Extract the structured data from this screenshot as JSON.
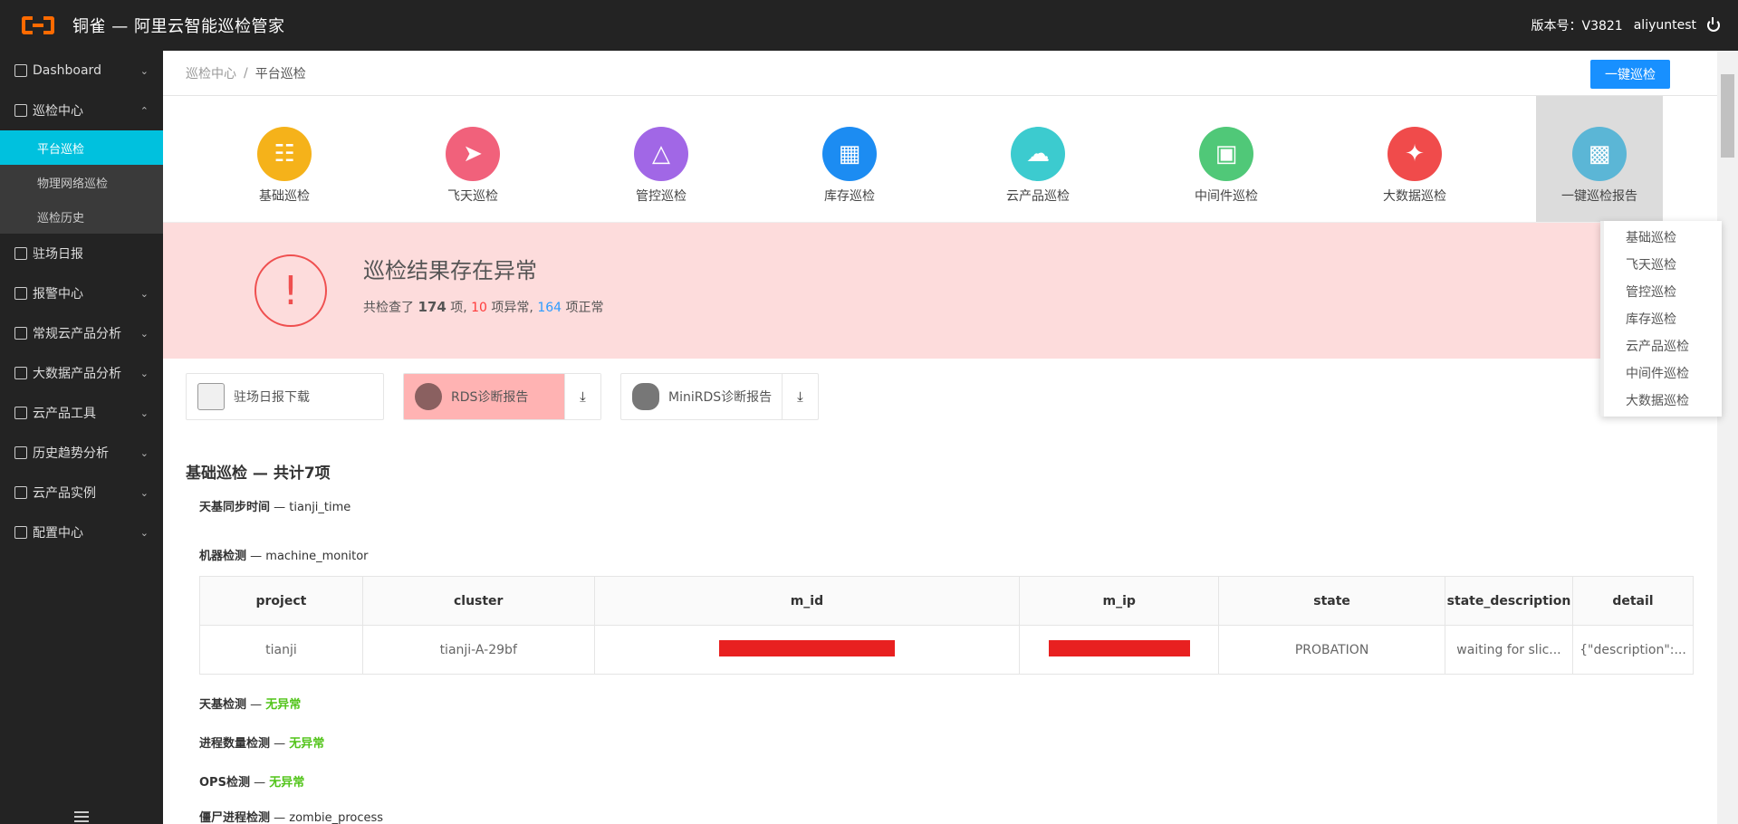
{
  "header": {
    "app_title": "铜雀 — 阿里云智能巡检管家",
    "version": "版本号：V3821",
    "username": "aliyuntest"
  },
  "sidebar": {
    "items": [
      {
        "label": "Dashboard",
        "icon": "home-icon",
        "expanded": false
      },
      {
        "label": "巡检中心",
        "icon": "inspect-icon",
        "expanded": true
      },
      {
        "label": "驻场日报",
        "icon": "edit-icon"
      },
      {
        "label": "报警中心",
        "icon": "alarm-icon",
        "expanded": false
      },
      {
        "label": "常规云产品分析",
        "icon": "cube-icon",
        "expanded": false
      },
      {
        "label": "大数据产品分析",
        "icon": "chart-icon",
        "expanded": false
      },
      {
        "label": "云产品工具",
        "icon": "tool-icon",
        "expanded": false
      },
      {
        "label": "历史趋势分析",
        "icon": "history-icon",
        "expanded": false
      },
      {
        "label": "云产品实例",
        "icon": "instance-icon",
        "expanded": false
      },
      {
        "label": "配置中心",
        "icon": "gear-icon",
        "expanded": false
      }
    ],
    "sub_items": [
      "平台巡检",
      "物理网络巡检",
      "巡检历史"
    ]
  },
  "breadcrumb": {
    "parent": "巡检中心",
    "separator": "/",
    "current": "平台巡检"
  },
  "actions": {
    "one_click": "一键巡检"
  },
  "categories": [
    {
      "label": "基础巡检",
      "color": "#f5b21a",
      "icon": "document-search-icon"
    },
    {
      "label": "飞天巡检",
      "color": "#f1617b",
      "icon": "rocket-icon"
    },
    {
      "label": "管控巡检",
      "color": "#a167e6",
      "icon": "network-icon"
    },
    {
      "label": "库存巡检",
      "color": "#1c8cf2",
      "icon": "grid-icon"
    },
    {
      "label": "云产品巡检",
      "color": "#3ccbcf",
      "icon": "cloud-icon"
    },
    {
      "label": "中间件巡检",
      "color": "#50c878",
      "icon": "box-icon"
    },
    {
      "label": "大数据巡检",
      "color": "#f04b4b",
      "icon": "nodes-icon"
    },
    {
      "label": "一键巡检报告",
      "color": "#5bb6d6",
      "icon": "report-icon"
    }
  ],
  "dropdown": [
    "基础巡检",
    "飞天巡检",
    "管控巡检",
    "库存巡检",
    "云产品巡检",
    "中间件巡检",
    "大数据巡检"
  ],
  "alert": {
    "title": "巡检结果存在异常",
    "prefix": "共检查了",
    "total": "174",
    "unit1": "项,",
    "abnormal": "10",
    "abnormal_suffix": "项异常,",
    "normal": "164",
    "normal_suffix": "项正常"
  },
  "downloads": [
    {
      "label": "驻场日报下载",
      "icon": "excel-icon"
    },
    {
      "label": "RDS诊断报告",
      "icon": "rds-icon",
      "download_icon": "download-icon"
    },
    {
      "label": "MiniRDS诊断报告",
      "icon": "database-icon",
      "download_icon": "download-icon"
    }
  ],
  "section": {
    "title": "基础巡检 — 共计7项",
    "checks": [
      {
        "name": "天基同步时间",
        "detail": "tianji_time"
      },
      {
        "name": "机器检测",
        "detail": "machine_monitor"
      }
    ],
    "table": {
      "headers": [
        "project",
        "cluster",
        "m_id",
        "m_ip",
        "state",
        "state_description",
        "detail"
      ],
      "row": [
        "tianji",
        "tianji-A-29bf",
        "",
        "",
        "PROBATION",
        "waiting for slic...",
        "{\"description\":..."
      ]
    },
    "status_checks": [
      {
        "name": "天基检测",
        "status": "无异常"
      },
      {
        "name": "进程数量检测",
        "status": "无异常"
      },
      {
        "name": "OPS检测",
        "status": "无异常"
      }
    ],
    "last_check": {
      "name": "僵尸进程检测",
      "detail": "zombie_process"
    }
  }
}
